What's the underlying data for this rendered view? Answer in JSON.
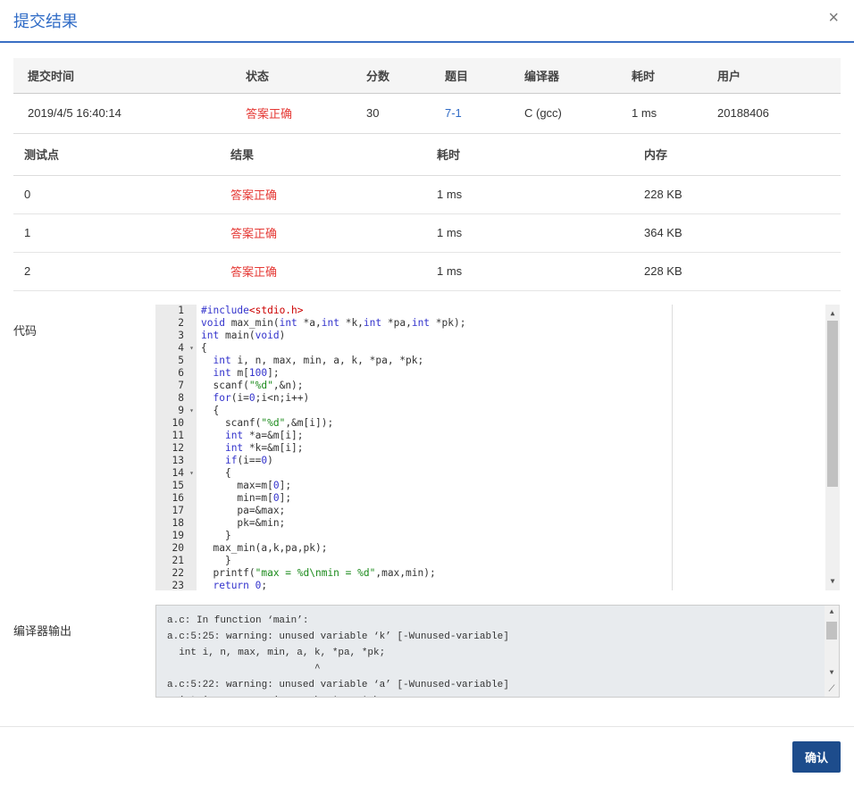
{
  "dialog": {
    "title": "提交结果",
    "close": "×",
    "confirm": "确认"
  },
  "summary": {
    "headers": [
      "提交时间",
      "状态",
      "分数",
      "题目",
      "编译器",
      "耗时",
      "用户"
    ],
    "row": {
      "time": "2019/4/5 16:40:14",
      "status": "答案正确",
      "score": "30",
      "problem": "7-1",
      "compiler": "C (gcc)",
      "duration": "1 ms",
      "user": "20188406"
    }
  },
  "tests": {
    "headers": [
      "测试点",
      "结果",
      "耗时",
      "内存"
    ],
    "rows": [
      [
        "0",
        "答案正确",
        "1 ms",
        "228 KB"
      ],
      [
        "1",
        "答案正确",
        "1 ms",
        "364 KB"
      ],
      [
        "2",
        "答案正确",
        "1 ms",
        "228 KB"
      ]
    ]
  },
  "code": {
    "label": "代码",
    "fold_lines": [
      4,
      9,
      14
    ],
    "lines": [
      "#include<stdio.h>",
      "void max_min(int *a,int *k,int *pa,int *pk);",
      "int main(void)",
      "{",
      "  int i, n, max, min, a, k, *pa, *pk;",
      "  int m[100];",
      "  scanf(\"%d\",&n);",
      "  for(i=0;i<n;i++)",
      "  {",
      "    scanf(\"%d\",&m[i]);",
      "    int *a=&m[i];",
      "    int *k=&m[i];",
      "    if(i==0)",
      "    {",
      "      max=m[0];",
      "      min=m[0];",
      "      pa=&max;",
      "      pk=&min;",
      "    }",
      "  max_min(a,k,pa,pk);",
      "    }",
      "  printf(\"max = %d\\nmin = %d\",max,min);",
      "  return 0;"
    ]
  },
  "compiler_output": {
    "label": "编译器输出",
    "lines": [
      "a.c: In function ‘main’:",
      "a.c:5:25: warning: unused variable ‘k’ [-Wunused-variable]",
      "  int i, n, max, min, a, k, *pa, *pk;",
      "                         ^",
      "a.c:5:22: warning: unused variable ‘a’ [-Wunused-variable]",
      "  int i, n, max, min, a, k, *pa, *pk;"
    ]
  }
}
